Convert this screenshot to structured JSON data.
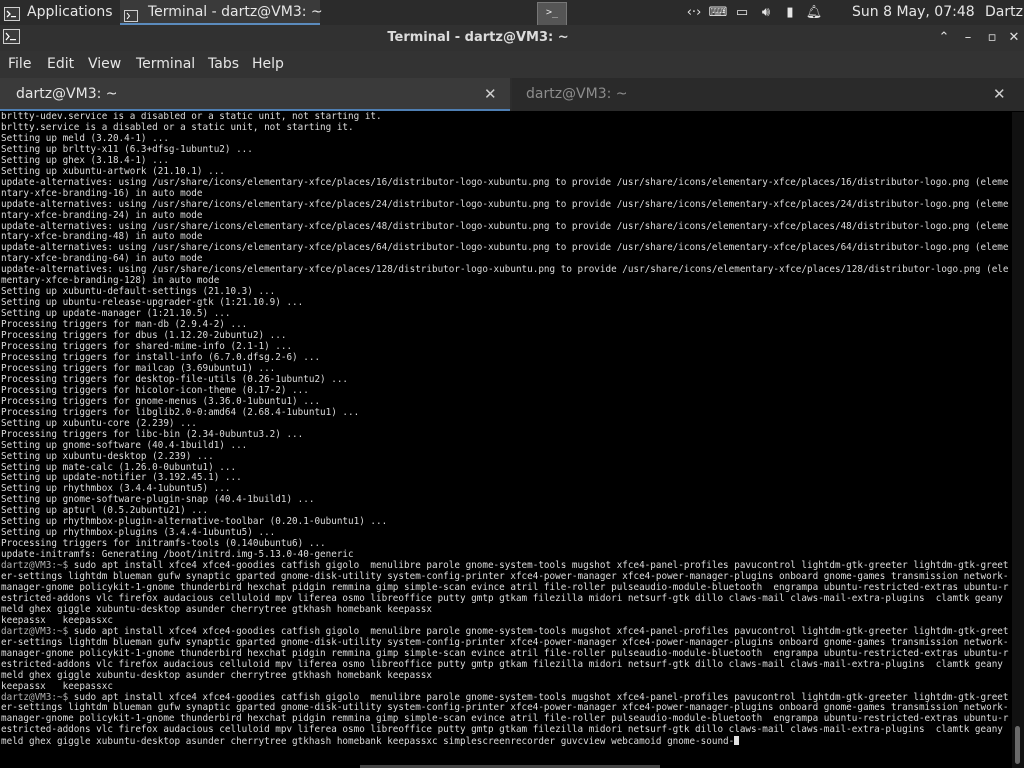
{
  "panel": {
    "applications_label": "Applications",
    "task_label": "Terminal - dartz@VM3: ~",
    "workspace_switcher": ">_",
    "tray_icons": [
      "network-icon",
      "keyboard-icon",
      "display-icon",
      "volume-icon",
      "battery-icon",
      "notification-bell-icon"
    ],
    "clock": "Sun  8 May, 07:48",
    "user": "Dartz"
  },
  "window": {
    "title": "Terminal - dartz@VM3: ~"
  },
  "menu": [
    "File",
    "Edit",
    "View",
    "Terminal",
    "Tabs",
    "Help"
  ],
  "tabs": [
    {
      "label": "dartz@VM3: ~",
      "active": true
    },
    {
      "label": "dartz@VM3: ~",
      "active": false
    }
  ],
  "terminal": {
    "lines": [
      "brltty-udev.service is a disabled or a static unit, not starting it.",
      "brltty.service is a disabled or a static unit, not starting it.",
      "Setting up meld (3.20.4-1) ...",
      "Setting up brltty-x11 (6.3+dfsg-1ubuntu2) ...",
      "Setting up ghex (3.18.4-1) ...",
      "Setting up xubuntu-artwork (21.10.1) ...",
      "update-alternatives: using /usr/share/icons/elementary-xfce/places/16/distributor-logo-xubuntu.png to provide /usr/share/icons/elementary-xfce/places/16/distributor-logo.png (elementary-xfce-branding-16) in auto mode",
      "update-alternatives: using /usr/share/icons/elementary-xfce/places/24/distributor-logo-xubuntu.png to provide /usr/share/icons/elementary-xfce/places/24/distributor-logo.png (elementary-xfce-branding-24) in auto mode",
      "update-alternatives: using /usr/share/icons/elementary-xfce/places/48/distributor-logo-xubuntu.png to provide /usr/share/icons/elementary-xfce/places/48/distributor-logo.png (elementary-xfce-branding-48) in auto mode",
      "update-alternatives: using /usr/share/icons/elementary-xfce/places/64/distributor-logo-xubuntu.png to provide /usr/share/icons/elementary-xfce/places/64/distributor-logo.png (elementary-xfce-branding-64) in auto mode",
      "update-alternatives: using /usr/share/icons/elementary-xfce/places/128/distributor-logo-xubuntu.png to provide /usr/share/icons/elementary-xfce/places/128/distributor-logo.png (elementary-xfce-branding-128) in auto mode",
      "Setting up xubuntu-default-settings (21.10.3) ...",
      "Setting up ubuntu-release-upgrader-gtk (1:21.10.9) ...",
      "Setting up update-manager (1:21.10.5) ...",
      "Processing triggers for man-db (2.9.4-2) ...",
      "Processing triggers for dbus (1.12.20-2ubuntu2) ...",
      "Processing triggers for shared-mime-info (2.1-1) ...",
      "Processing triggers for install-info (6.7.0.dfsg.2-6) ...",
      "Processing triggers for mailcap (3.69ubuntu1) ...",
      "Processing triggers for desktop-file-utils (0.26-1ubuntu2) ...",
      "Processing triggers for hicolor-icon-theme (0.17-2) ...",
      "Processing triggers for gnome-menus (3.36.0-1ubuntu1) ...",
      "Processing triggers for libglib2.0-0:amd64 (2.68.4-1ubuntu1) ...",
      "Setting up xubuntu-core (2.239) ...",
      "Processing triggers for libc-bin (2.34-0ubuntu3.2) ...",
      "Setting up gnome-software (40.4-1build1) ...",
      "Setting up xubuntu-desktop (2.239) ...",
      "Setting up mate-calc (1.26.0-0ubuntu1) ...",
      "Setting up update-notifier (3.192.45.1) ...",
      "Setting up rhythmbox (3.4.4-1ubuntu5) ...",
      "Setting up gnome-software-plugin-snap (40.4-1build1) ...",
      "Setting up apturl (0.5.2ubuntu21) ...",
      "Setting up rhythmbox-plugin-alternative-toolbar (0.20.1-0ubuntu1) ...",
      "Setting up rhythmbox-plugins (3.4.4-1ubuntu5) ...",
      "Processing triggers for initramfs-tools (0.140ubuntu6) ...",
      "update-initramfs: Generating /boot/initrd.img-5.13.0-40-generic"
    ],
    "prompt": "dartz@VM3:~$",
    "commands": [
      " sudo apt install xfce4 xfce4-goodies catfish gigolo  menulibre parole gnome-system-tools mugshot xfce4-panel-profiles pavucontrol lightdm-gtk-greeter lightdm-gtk-greeter-settings lightdm blueman gufw synaptic gparted gnome-disk-utility system-config-printer xfce4-power-manager xfce4-power-manager-plugins onboard gnome-games transmission network-manager-gnome policykit-1-gnome thunderbird hexchat pidgin remmina gimp simple-scan evince atril file-roller pulseaudio-module-bluetooth  engrampa ubuntu-restricted-extras ubuntu-restricted-addons vlc firefox audacious celluloid mpv liferea osmo libreoffice putty gmtp gtkam filezilla midori netsurf-gtk dillo claws-mail claws-mail-extra-plugins  clamtk geany meld ghex giggle xubuntu-desktop asunder cherrytree gtkhash homebank keepassx\nkeepassx   keepassxc",
      " sudo apt install xfce4 xfce4-goodies catfish gigolo  menulibre parole gnome-system-tools mugshot xfce4-panel-profiles pavucontrol lightdm-gtk-greeter lightdm-gtk-greeter-settings lightdm blueman gufw synaptic gparted gnome-disk-utility system-config-printer xfce4-power-manager xfce4-power-manager-plugins onboard gnome-games transmission network-manager-gnome policykit-1-gnome thunderbird hexchat pidgin remmina gimp simple-scan evince atril file-roller pulseaudio-module-bluetooth  engrampa ubuntu-restricted-extras ubuntu-restricted-addons vlc firefox audacious celluloid mpv liferea osmo libreoffice putty gmtp gtkam filezilla midori netsurf-gtk dillo claws-mail claws-mail-extra-plugins  clamtk geany meld ghex giggle xubuntu-desktop asunder cherrytree gtkhash homebank keepassx\nkeepassx   keepassxc",
      " sudo apt install xfce4 xfce4-goodies catfish gigolo  menulibre parole gnome-system-tools mugshot xfce4-panel-profiles pavucontrol lightdm-gtk-greeter lightdm-gtk-greeter-settings lightdm blueman gufw synaptic gparted gnome-disk-utility system-config-printer xfce4-power-manager xfce4-power-manager-plugins onboard gnome-games transmission network-manager-gnome policykit-1-gnome thunderbird hexchat pidgin remmina gimp simple-scan evince atril file-roller pulseaudio-module-bluetooth  engrampa ubuntu-restricted-extras ubuntu-restricted-addons vlc firefox audacious celluloid mpv liferea osmo libreoffice putty gmtp gtkam filezilla midori netsurf-gtk dillo claws-mail claws-mail-extra-plugins  clamtk geany meld ghex giggle xubuntu-desktop asunder cherrytree gtkhash homebank keepassxc simplescreenrecorder guvcview webcamoid gnome-sound-"
    ]
  },
  "colors": {
    "panel_bg": "#2b2b2b",
    "titlebar_bg": "#313131",
    "menubar_bg": "#333333",
    "tab_active_bg": "#3a3a3a",
    "tab_accent": "#4f7fb3",
    "terminal_bg": "#000000",
    "terminal_fg": "#dcdcdc"
  }
}
